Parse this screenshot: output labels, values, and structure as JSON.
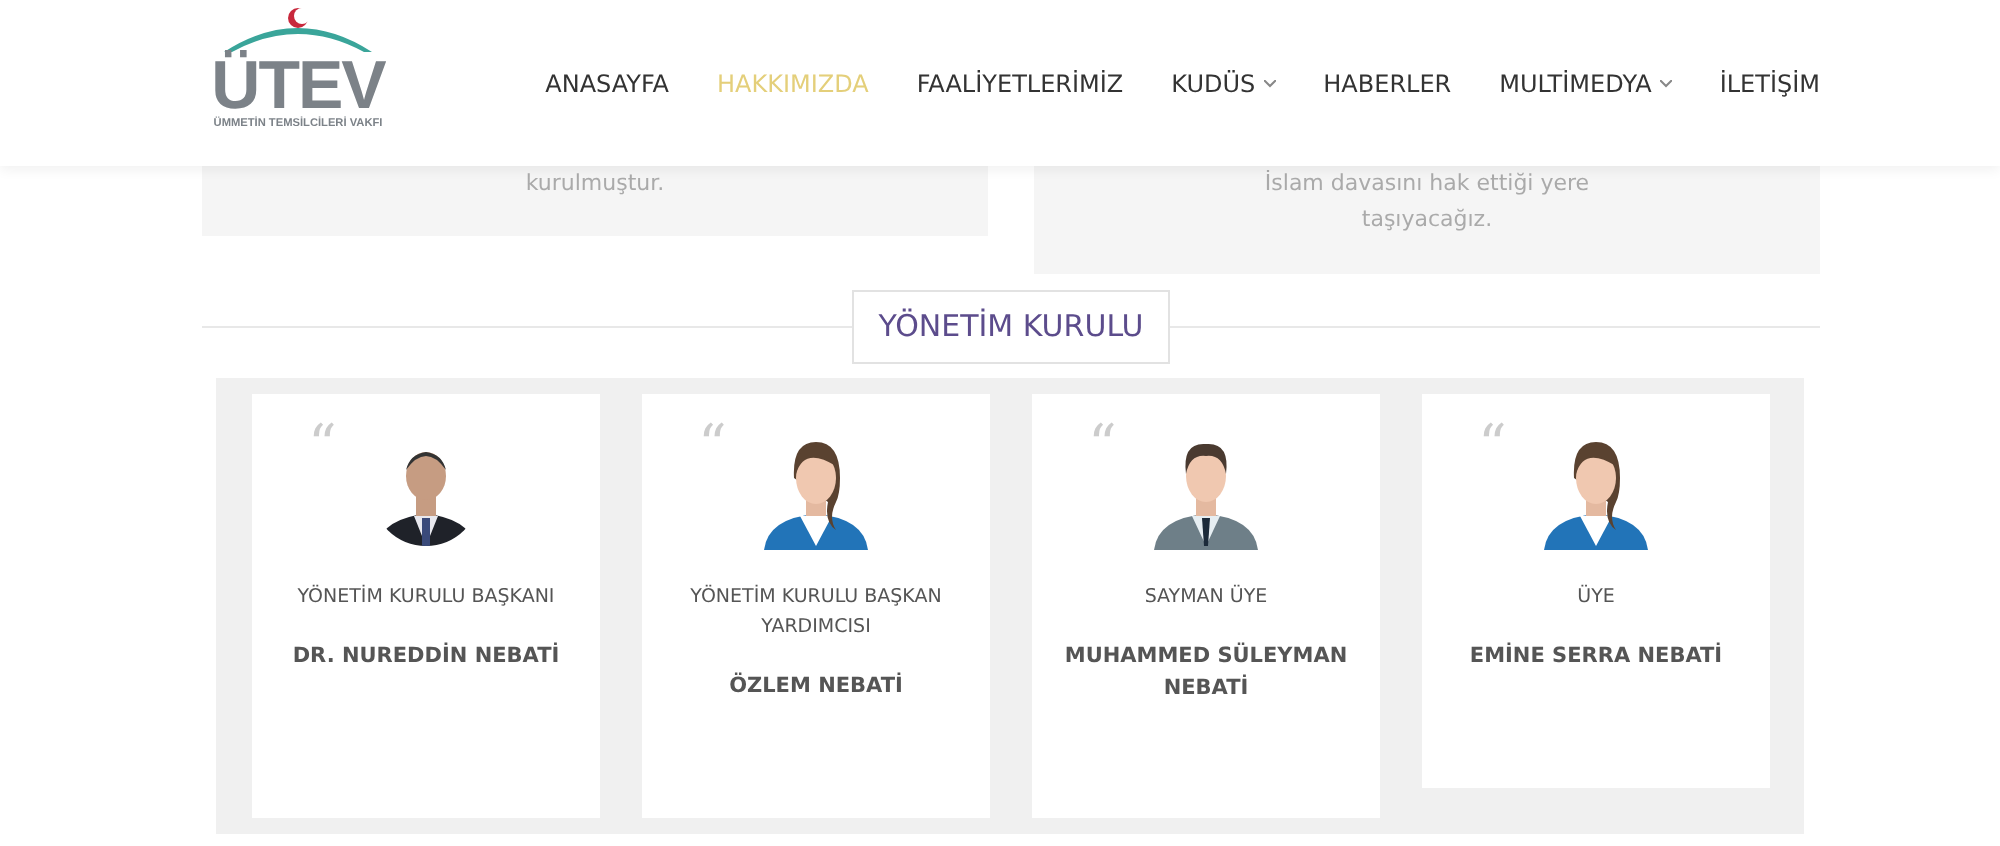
{
  "header": {
    "logo": {
      "letters": "ÜTEV",
      "tagline": "ÜMMETİN TEMSİLCİLERİ VAKFI"
    },
    "nav": [
      {
        "label": "ANASAYFA",
        "selected": false,
        "dropdown": false
      },
      {
        "label": "HAKKIMIZDA",
        "selected": true,
        "dropdown": false
      },
      {
        "label": "FAALİYETLERİMİZ",
        "selected": false,
        "dropdown": false
      },
      {
        "label": "KUDÜS",
        "selected": false,
        "dropdown": true
      },
      {
        "label": "HABERLER",
        "selected": false,
        "dropdown": false
      },
      {
        "label": "MULTİMEDYA",
        "selected": false,
        "dropdown": true
      },
      {
        "label": "İLETİŞİM",
        "selected": false,
        "dropdown": false
      }
    ]
  },
  "panels": [
    {
      "lines": [
        "kurulmuştur."
      ]
    },
    {
      "lines": [
        "İslam davasını hak ettiği yere",
        "taşıyacağız."
      ]
    }
  ],
  "section_title": "YÖNETİM KURULU",
  "members": [
    {
      "quote": "“",
      "role": "YÖNETİM KURULU BAŞKANI",
      "name": "DR. NUREDDİN NEBATİ"
    },
    {
      "kind": "woman",
      "quote": "“",
      "role": "YÖNETİM KURULU BAŞKAN YARDIMCISI",
      "name": "ÖZLEM NEBATİ"
    },
    {
      "kind": "man",
      "quote": "“",
      "role": "SAYMAN ÜYE",
      "name": "MUHAMMED SÜLEYMAN NEBATİ"
    },
    {
      "kind": "woman",
      "quote": "“",
      "role": "ÜYE",
      "name": "EMİNE SERRA NEBATİ"
    }
  ]
}
